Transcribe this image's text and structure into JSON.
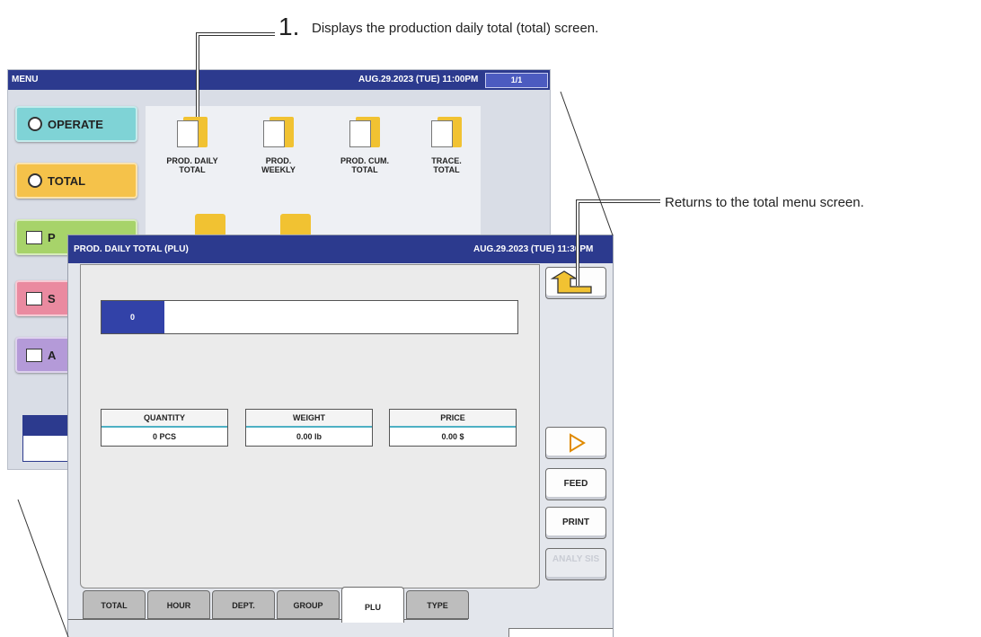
{
  "callouts": {
    "one_number": "1.",
    "one_text": "Displays the production daily total (total) screen.",
    "two_text": "Returns to the total menu screen."
  },
  "menu_screen": {
    "title": "MENU",
    "datetime": "AUG.29.2023 (TUE)  11:00PM",
    "page": "1/1",
    "side_buttons": [
      {
        "label": "OPERATE",
        "color": "#7fd3d6"
      },
      {
        "label": "TOTAL",
        "color": "#f5c24a"
      },
      {
        "label": "P",
        "color": "#a7d36a"
      },
      {
        "label": "S",
        "color": "#ea8aa0"
      },
      {
        "label": "A",
        "color": "#b49ad8"
      }
    ],
    "icons": [
      {
        "label_line1": "PROD. DAILY",
        "label_line2": "TOTAL",
        "icon": "calendar-icon"
      },
      {
        "label_line1": "PROD.",
        "label_line2": "WEEKLY",
        "icon": "weekly-icon"
      },
      {
        "label_line1": "PROD. CUM.",
        "label_line2": "TOTAL",
        "icon": "cumulative-icon"
      },
      {
        "label_line1": "TRACE.",
        "label_line2": "TOTAL",
        "icon": "trace-icon"
      }
    ]
  },
  "daily_total": {
    "title": "PROD. DAILY TOTAL (PLU)",
    "datetime": "AUG.29.2023 (TUE)  11:30PM",
    "plu_code": "0",
    "stats": [
      {
        "header": "QUANTITY",
        "value": "0 PCS"
      },
      {
        "header": "WEIGHT",
        "value": "0.00 lb"
      },
      {
        "header": "PRICE",
        "value": "0.00 $"
      }
    ],
    "buttons": {
      "feed": "FEED",
      "print": "PRINT",
      "analysis": "ANALY SIS"
    },
    "tabs": [
      "TOTAL",
      "HOUR",
      "DEPT.",
      "GROUP",
      "PLU",
      "TYPE"
    ],
    "active_tab": "PLU",
    "colors": {
      "titlebar": "#2c3a8e",
      "plu_code_bg": "#3242a8",
      "stat_underline": "#4eb0c4"
    }
  }
}
